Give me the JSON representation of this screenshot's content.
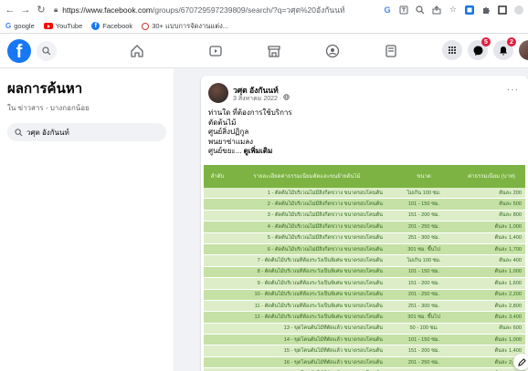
{
  "browser": {
    "url_host": "https://www.facebook.com",
    "url_path": "/groups/670729597239809/search/?q=วศุต%20อังกันนท์",
    "bookmarks": [
      {
        "icon": "google-icon",
        "label": "google"
      },
      {
        "icon": "youtube-icon",
        "label": "YouTube"
      },
      {
        "icon": "facebook-icon",
        "label": "Facebook"
      },
      {
        "icon": "other-bookmark-icon",
        "label": "30+ แบบการจัดงานแต่ง..."
      }
    ]
  },
  "header": {
    "notification_badges": [
      "5",
      "2"
    ]
  },
  "sidebar": {
    "title": "ผลการค้นหา",
    "subtitle": "ใน ข่าวสาร - บางกอกน้อย",
    "search_value": "วศุต อังกันนท์"
  },
  "post": {
    "author": "วศุต อังกันนท์",
    "date": "3 สิงหาคม 2022 · ",
    "lines": [
      "ท่านใด ที่ต้องการใช้บริการ",
      "ตัดต้นไม้",
      "ศูนย์สิ่งปฏิกูล",
      "พนยาซ่าแมลง"
    ],
    "last_line": "ศูนย์ขยะ... ",
    "see_more": "ดูเพิ่มเติม"
  },
  "price_table": {
    "headers": [
      "ลำดับ",
      "รายละเอียดค่าธรรมเนียมตัดและขนย้ายต้นไม้",
      "ขนาด",
      "ค่าธรรมเนียม (บาท)"
    ],
    "rows": [
      [
        "1 - ตัดต้นไม้บริเวณไม่มีสิ่งกีดขวาง ขนาดรอบโคนต้น",
        "ไม่เกิน 100 ซม.",
        "ต้นละ 200"
      ],
      [
        "2 - ตัดต้นไม้บริเวณไม่มีสิ่งกีดขวาง ขนาดรอบโคนต้น",
        "101 - 150 ซม.",
        "ต้นละ 500"
      ],
      [
        "3 - ตัดต้นไม้บริเวณไม่มีสิ่งกีดขวาง ขนาดรอบโคนต้น",
        "151 - 200 ซม.",
        "ต้นละ 800"
      ],
      [
        "4 - ตัดต้นไม้บริเวณไม่มีสิ่งกีดขวาง ขนาดรอบโคนต้น",
        "201 - 250 ซม.",
        "ต้นละ 1,000"
      ],
      [
        "5 - ตัดต้นไม้บริเวณไม่มีสิ่งกีดขวาง ขนาดรอบโคนต้น",
        "251 - 300 ซม.",
        "ต้นละ 1,400"
      ],
      [
        "6 - ตัดต้นไม้บริเวณไม่มีสิ่งกีดขวาง ขนาดรอบโคนต้น",
        "301 ซม. ขึ้นไป",
        "ต้นละ 1,700"
      ],
      [
        "7 - ตัดต้นไม้บริเวณที่ต้องระวังเป็นพิเศษ ขนาดรอบโคนต้น",
        "ไม่เกิน 100 ซม.",
        "ต้นละ 400"
      ],
      [
        "8 - ตัดต้นไม้บริเวณที่ต้องระวังเป็นพิเศษ ขนาดรอบโคนต้น",
        "101 - 150 ซม.",
        "ต้นละ 1,000"
      ],
      [
        "9 - ตัดต้นไม้บริเวณที่ต้องระวังเป็นพิเศษ ขนาดรอบโคนต้น",
        "151 - 200 ซม.",
        "ต้นละ 1,600"
      ],
      [
        "10 - ตัดต้นไม้บริเวณที่ต้องระวังเป็นพิเศษ ขนาดรอบโคนต้น",
        "201 - 250 ซม.",
        "ต้นละ 2,200"
      ],
      [
        "11 - ตัดต้นไม้บริเวณที่ต้องระวังเป็นพิเศษ ขนาดรอบโคนต้น",
        "251 - 300 ซม.",
        "ต้นละ 2,800"
      ],
      [
        "12 - ตัดต้นไม้บริเวณที่ต้องระวังเป็นพิเศษ ขนาดรอบโคนต้น",
        "301 ซม. ขึ้นไป",
        "ต้นละ 3,400"
      ],
      [
        "13 - ขุดโคนต้นไม้ที่ตัดแล้ว ขนาดรอบโคนต้น",
        "50 - 100 ซม.",
        "ต้นละ 600"
      ],
      [
        "14 - ขุดโคนต้นไม้ที่ตัดแล้ว ขนาดรอบโคนต้น",
        "101 - 150 ซม.",
        "ต้นละ 1,000"
      ],
      [
        "15 - ขุดโคนต้นไม้ที่ตัดแล้ว ขนาดรอบโคนต้น",
        "151 - 200 ซม.",
        "ต้นละ 1,400"
      ],
      [
        "16 - ขุดโคนต้นไม้ที่ตัดแล้ว ขนาดรอบโคนต้น",
        "201 - 250 ซม.",
        "ต้นละ 2,000"
      ],
      [
        "17 - ขุดโคนต้นไม้ที่ตัดแล้ว ขนาดรอบโคนต้น",
        "251 - 300 ซม.",
        "ต้นละ 2,600"
      ]
    ]
  },
  "colors": {
    "fb_blue": "#1877f2",
    "table_header": "#7cb342",
    "table_row_light": "#dcedc8",
    "table_row_dark": "#c5e1a5",
    "badge_red": "#e41e3f"
  }
}
